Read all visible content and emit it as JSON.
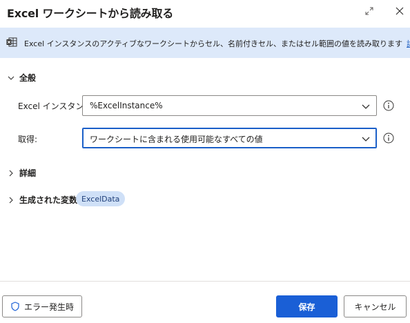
{
  "dialog": {
    "title": "Excel ワークシートから読み取る",
    "info_text": "Excel インスタンスのアクティブなワークシートからセル、名前付きセル、またはセル範囲の値を読み取ります",
    "info_link": "詳細"
  },
  "sections": {
    "general": "全般",
    "details": "詳細",
    "variables": "生成された変数"
  },
  "fields": {
    "excel_instance": {
      "label": "Excel インスタンス:",
      "value": "%ExcelInstance%"
    },
    "retrieve": {
      "label": "取得:",
      "value": "ワークシートに含まれる使用可能なすべての値"
    }
  },
  "variables": [
    "ExcelData"
  ],
  "footer": {
    "on_error": "エラー発生時",
    "save": "保存",
    "cancel": "キャンセル"
  },
  "colors": {
    "accent": "#1a5fd6",
    "info_bg": "#dde9fa",
    "pill_bg": "#cfe0f7"
  }
}
